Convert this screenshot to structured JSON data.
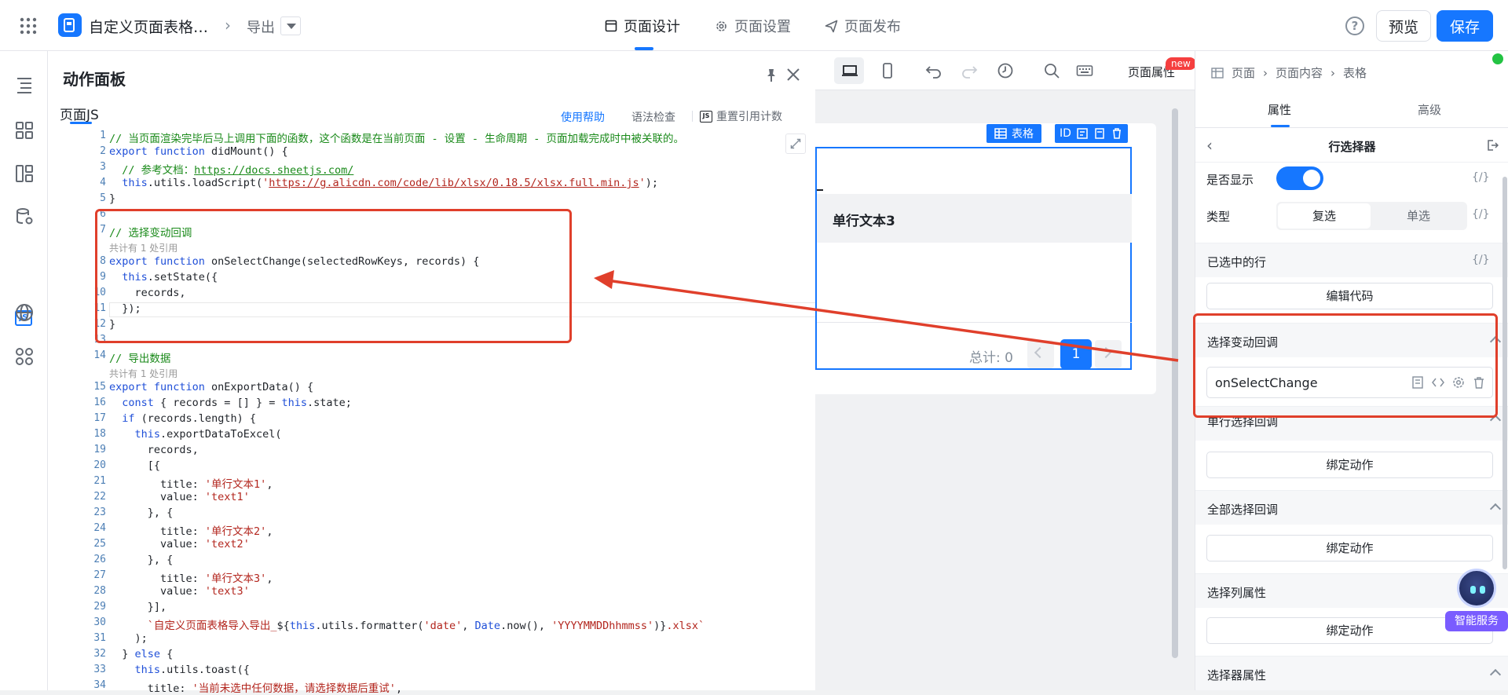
{
  "topbar": {
    "app_title": "自定义页面表格导入导出",
    "breadcrumb_current": "导出",
    "tabs": [
      "页面设计",
      "页面设置",
      "页面发布"
    ],
    "preview_label": "预览",
    "save_label": "保存",
    "help_glyph": "?"
  },
  "action_panel": {
    "title": "动作面板",
    "tab": "页面JS",
    "help_link": "使用帮助",
    "grammar_check": "语法检查",
    "reset_refs": "重置引用计数",
    "js_badge": "JS"
  },
  "code": {
    "ref_count_1": "共计有 1 处引用",
    "ref_count_2": "共计有 1 处引用",
    "lines": [
      "// 当页面渲染完毕后马上调用下面的函数，这个函数是在当前页面 - 设置 - 生命周期 - 页面加载完成时中被关联的。",
      "export function didMount() {",
      "  // 参考文档：https://docs.sheetjs.com/",
      "  this.utils.loadScript('https://g.alicdn.com/code/lib/xlsx/0.18.5/xlsx.full.min.js');",
      "}",
      "",
      "// 选择变动回调",
      "export function onSelectChange(selectedRowKeys, records) {",
      "  this.setState({",
      "    records,",
      "  });",
      "}",
      "",
      "// 导出数据",
      "export function onExportData() {",
      "  const { records = [] } = this.state;",
      "  if (records.length) {",
      "    this.exportDataToExcel(",
      "      records,",
      "      [{",
      "        title: '单行文本1',",
      "        value: 'text1'",
      "      }, {",
      "        title: '单行文本2',",
      "        value: 'text2'",
      "      }, {",
      "        title: '单行文本3',",
      "        value: 'text3'",
      "      }],",
      "      `自定义页面表格导入导出_${this.utils.formatter('date', Date.now(), 'YYYYMMDDhhmmss')}.xlsx`",
      "    );",
      "  } else {",
      "    this.utils.toast({",
      "      title: '当前未选中任何数据，请选择数据后重试',"
    ]
  },
  "canvas": {
    "page_attr": "页面属性",
    "new_badge": "new",
    "table_tag": "表格",
    "id_tag": "ID",
    "column_header": "单行文本3",
    "total_label": "总计: 0",
    "current_page": "1"
  },
  "right_panel": {
    "breadcrumb": [
      "页面",
      "页面内容",
      "表格"
    ],
    "tabs": [
      "属性",
      "高级"
    ],
    "sub_title": "行选择器",
    "show_label": "是否显示",
    "expr_glyph": "{/}",
    "type_label": "类型",
    "type_options": [
      "复选",
      "单选"
    ],
    "selected_rows_label": "已选中的行",
    "edit_code": "编辑代码",
    "sections": [
      {
        "title": "选择变动回调",
        "value": "onSelectChange"
      },
      {
        "title": "单行选择回调",
        "button": "绑定动作"
      },
      {
        "title": "全部选择回调",
        "button": "绑定动作"
      },
      {
        "title": "选择列属性",
        "button": "绑定动作"
      },
      {
        "title": "选择器属性"
      }
    ]
  },
  "assistant": {
    "label": "智能服务"
  },
  "colors": {
    "primary": "#1677ff",
    "annotation_red": "#e03f2b",
    "comment_green": "#1a8a1a",
    "keyword_blue": "#1f4fd8",
    "string_red": "#b3261e"
  }
}
